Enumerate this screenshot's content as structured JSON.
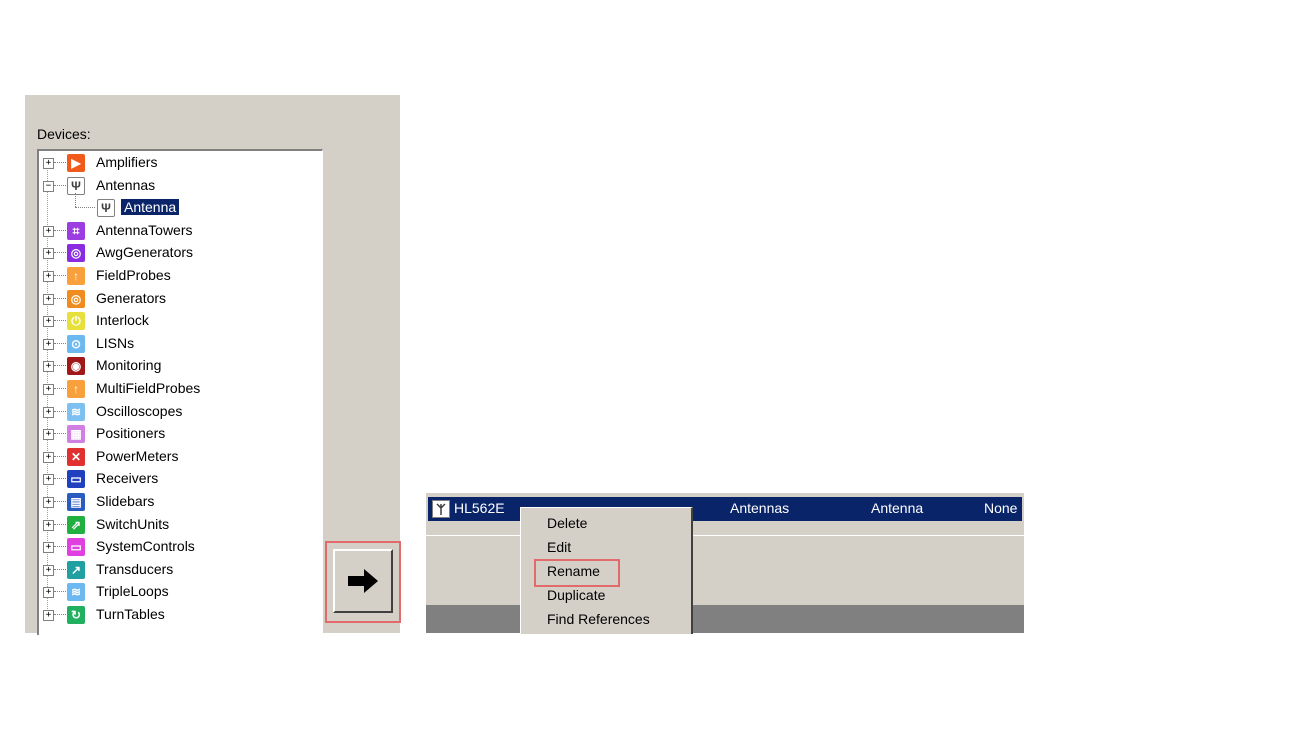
{
  "devices_panel": {
    "label": "Devices:",
    "items": [
      {
        "label": "Amplifiers",
        "icon": "amplifier-icon",
        "color": "#f05a1a",
        "glyph": "▶",
        "expander": "+"
      },
      {
        "label": "Antennas",
        "icon": "antenna-icon",
        "color": "#ffffff",
        "glyph": "Ψ",
        "expander": "−"
      },
      {
        "label": "Antenna",
        "icon": "antenna-icon",
        "color": "#ffffff",
        "glyph": "Ψ",
        "child": true,
        "selected": true
      },
      {
        "label": "AntennaTowers",
        "icon": "antenna-tower-icon",
        "color": "#9b3de0",
        "glyph": "⌗",
        "expander": "+"
      },
      {
        "label": "AwgGenerators",
        "icon": "awg-generator-icon",
        "color": "#8a2be2",
        "glyph": "◎",
        "expander": "+"
      },
      {
        "label": "FieldProbes",
        "icon": "field-probe-icon",
        "color": "#f7a03c",
        "glyph": "↑",
        "expander": "+"
      },
      {
        "label": "Generators",
        "icon": "generator-icon",
        "color": "#f08c1e",
        "glyph": "◎",
        "expander": "+"
      },
      {
        "label": "Interlock",
        "icon": "interlock-icon",
        "color": "#e8e03a",
        "glyph": "⏻",
        "expander": "+"
      },
      {
        "label": "LISNs",
        "icon": "lisn-icon",
        "color": "#6cb8f0",
        "glyph": "⊙",
        "expander": "+"
      },
      {
        "label": "Monitoring",
        "icon": "monitoring-icon",
        "color": "#a01818",
        "glyph": "◉",
        "expander": "+"
      },
      {
        "label": "MultiFieldProbes",
        "icon": "multi-field-probe-icon",
        "color": "#f7a03c",
        "glyph": "↑",
        "expander": "+"
      },
      {
        "label": "Oscilloscopes",
        "icon": "oscilloscope-icon",
        "color": "#7ec0f0",
        "glyph": "≋",
        "expander": "+"
      },
      {
        "label": "Positioners",
        "icon": "positioner-icon",
        "color": "#d080e0",
        "glyph": "▦",
        "expander": "+"
      },
      {
        "label": "PowerMeters",
        "icon": "power-meter-icon",
        "color": "#e03030",
        "glyph": "✕",
        "expander": "+"
      },
      {
        "label": "Receivers",
        "icon": "receiver-icon",
        "color": "#2040c0",
        "glyph": "▭",
        "expander": "+"
      },
      {
        "label": "Slidebars",
        "icon": "slidebar-icon",
        "color": "#2a5cc0",
        "glyph": "▤",
        "expander": "+"
      },
      {
        "label": "SwitchUnits",
        "icon": "switch-unit-icon",
        "color": "#20b040",
        "glyph": "⇗",
        "expander": "+"
      },
      {
        "label": "SystemControls",
        "icon": "system-control-icon",
        "color": "#e040e0",
        "glyph": "▭",
        "expander": "+"
      },
      {
        "label": "Transducers",
        "icon": "transducer-icon",
        "color": "#20a0a0",
        "glyph": "↗",
        "expander": "+"
      },
      {
        "label": "TripleLoops",
        "icon": "triple-loop-icon",
        "color": "#6cb8f0",
        "glyph": "≋",
        "expander": "+"
      },
      {
        "label": "TurnTables",
        "icon": "turntable-icon",
        "color": "#20b060",
        "glyph": "↻",
        "expander": "+"
      }
    ]
  },
  "arrow_button": {
    "icon": "right-arrow-icon"
  },
  "list": {
    "selected_row": {
      "name": "HL562E",
      "category": "Antennas",
      "type": "Antenna",
      "extra": "None",
      "icon": "antenna-icon"
    }
  },
  "context_menu": {
    "items": [
      "Delete",
      "Edit",
      "Rename",
      "Duplicate",
      "Find References"
    ],
    "highlighted": "Rename"
  },
  "colors": {
    "panel_bg": "#d4d0c8",
    "selection": "#0a246a",
    "highlight_frame": "#e26a6a"
  }
}
